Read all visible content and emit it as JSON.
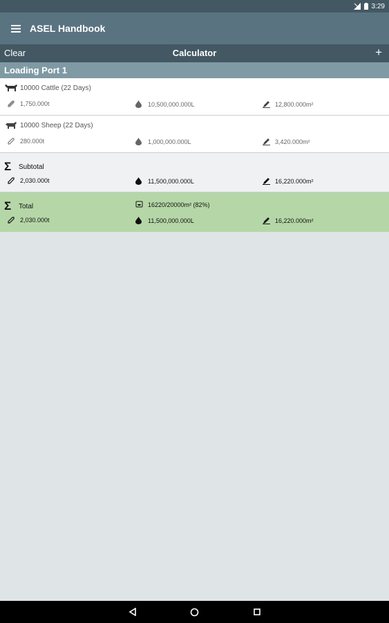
{
  "status_bar": {
    "time": "3:29"
  },
  "app_bar": {
    "title": "ASEL Handbook"
  },
  "toolbar": {
    "clear_label": "Clear",
    "title": "Calculator",
    "add_label": "+"
  },
  "section": {
    "title": "Loading Port 1"
  },
  "rows": [
    {
      "title": "10000 Cattle (22 Days)",
      "icon": "cattle-icon",
      "weight": "1,750.000t",
      "water": "10,500,000.000L",
      "area": "12,800.000m²"
    },
    {
      "title": "10000 Sheep (22 Days)",
      "icon": "sheep-icon",
      "weight": "280.000t",
      "water": "1,000,000.000L",
      "area": "3,420.000m²"
    }
  ],
  "subtotal": {
    "title": "Subtotal",
    "weight": "2,030.000t",
    "water": "11,500,000.000L",
    "area": "16,220.000m²"
  },
  "total": {
    "title": "Total",
    "capacity": "16220/20000m² (82%)",
    "weight": "2,030.000t",
    "water": "11,500,000.000L",
    "area": "16,220.000m²"
  }
}
